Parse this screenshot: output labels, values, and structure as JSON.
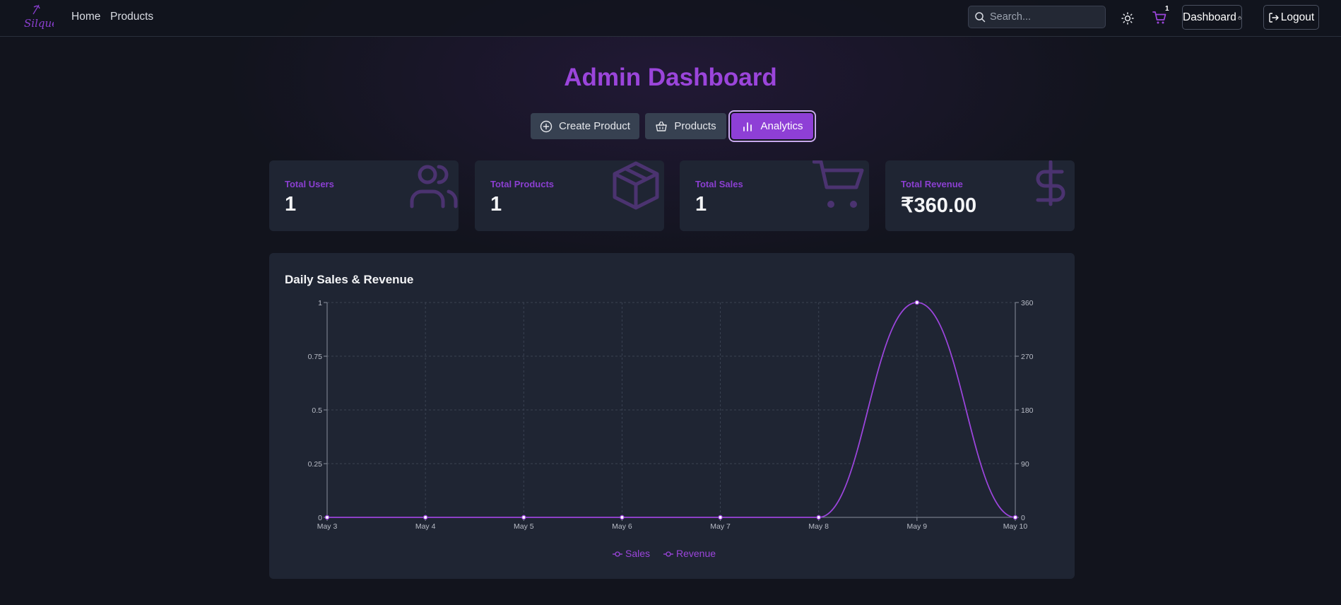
{
  "nav": {
    "logo_text": "Silque",
    "home_label": "Home",
    "products_label": "Products",
    "search_placeholder": "Search...",
    "cart_count": "1",
    "dashboard_label": "Dashboard",
    "logout_label": "Logout"
  },
  "page": {
    "title": "Admin Dashboard"
  },
  "tabs": [
    {
      "label": "Create Product",
      "icon": "plus-circle-icon"
    },
    {
      "label": "Products",
      "icon": "basket-icon"
    },
    {
      "label": "Analytics",
      "icon": "bar-chart-icon",
      "active": true
    }
  ],
  "stats": [
    {
      "label": "Total Users",
      "value": "1",
      "icon": "users-icon"
    },
    {
      "label": "Total Products",
      "value": "1",
      "icon": "package-icon"
    },
    {
      "label": "Total Sales",
      "value": "1",
      "icon": "cart-icon"
    },
    {
      "label": "Total Revenue",
      "value": "₹360.00",
      "icon": "dollar-icon"
    }
  ],
  "colors": {
    "accent": "#8e3fd6",
    "line": "#9b45db",
    "card_bg": "#1f2533",
    "page_bg": "#12141d"
  },
  "chart_data": {
    "type": "line",
    "title": "Daily Sales & Revenue",
    "categories": [
      "May 3",
      "May 4",
      "May 5",
      "May 6",
      "May 7",
      "May 8",
      "May 9",
      "May 10"
    ],
    "series": [
      {
        "name": "Sales",
        "axis": "left",
        "values": [
          0,
          0,
          0,
          0,
          0,
          0,
          1,
          0
        ]
      },
      {
        "name": "Revenue",
        "axis": "right",
        "values": [
          0,
          0,
          0,
          0,
          0,
          0,
          360,
          0
        ]
      }
    ],
    "y_left": {
      "min": 0,
      "max": 1,
      "ticks": [
        "0",
        "0.25",
        "0.5",
        "0.75",
        "1"
      ]
    },
    "y_right": {
      "min": 0,
      "max": 360,
      "ticks": [
        "0",
        "90",
        "180",
        "270",
        "360"
      ]
    },
    "grid": true,
    "legend_position": "bottom-center"
  }
}
